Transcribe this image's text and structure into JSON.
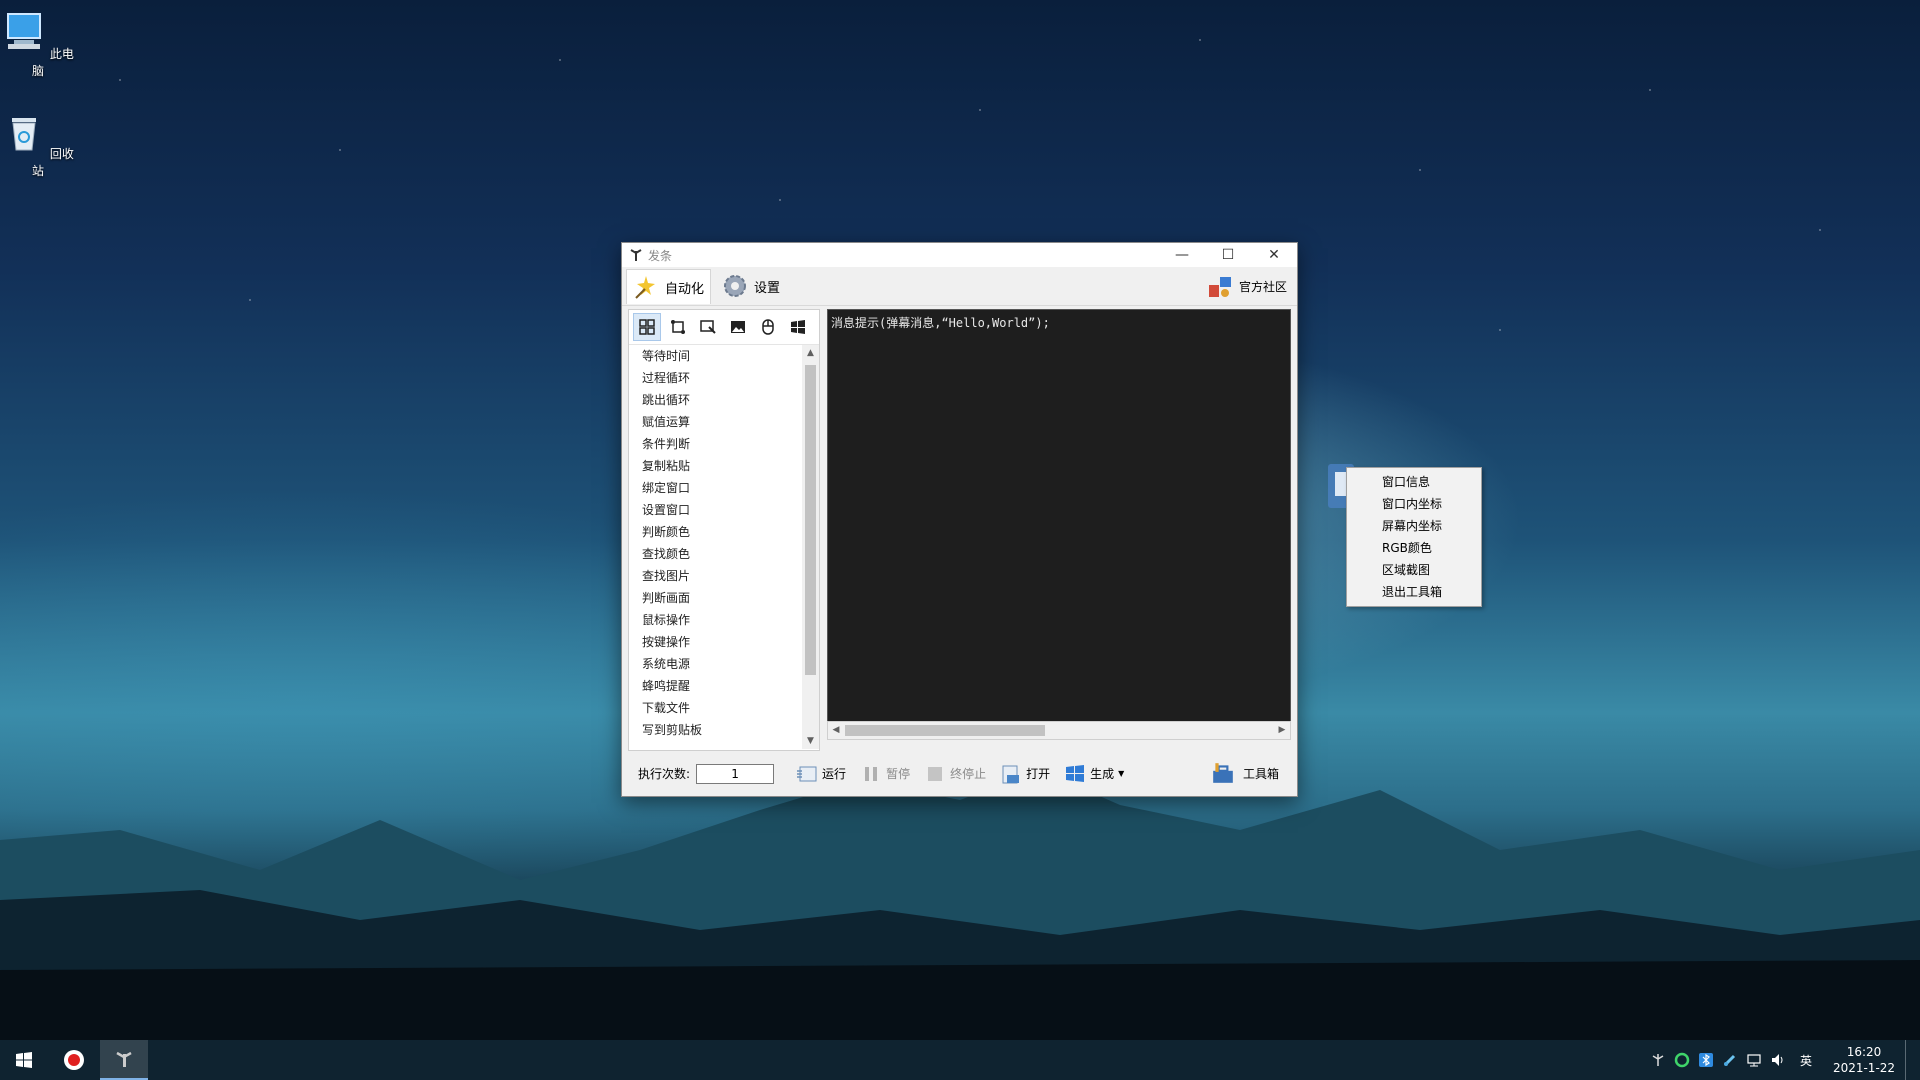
{
  "desktop": {
    "icons": [
      {
        "label": "此电脑",
        "icon": "computer-icon"
      },
      {
        "label": "回收站",
        "icon": "recycle-bin-icon"
      }
    ]
  },
  "window": {
    "title": "发条",
    "controls": {
      "minimize": "—",
      "maximize": "☐",
      "close": "✕"
    },
    "tabs": [
      {
        "label": "自动化",
        "icon": "magic-wand-icon",
        "active": true
      },
      {
        "label": "设置",
        "icon": "gear-icon",
        "active": false
      }
    ],
    "community_label": "官方社区",
    "category_icons": [
      "layout-grid-icon",
      "flow-icon",
      "window-select-icon",
      "image-icon",
      "mouse-icon",
      "windows-logo-icon"
    ],
    "commands": [
      "等待时间",
      "过程循环",
      "跳出循环",
      "赋值运算",
      "条件判断",
      "复制粘贴",
      "绑定窗口",
      "设置窗口",
      "判断颜色",
      "查找颜色",
      "查找图片",
      "判断画面",
      "鼠标操作",
      "按键操作",
      "系统电源",
      "蜂鸣提醒",
      "下载文件",
      "写到剪贴板"
    ],
    "editor_code": "消息提示(弹幕消息,“Hello,World”);",
    "bottom": {
      "exec_count_label": "执行次数:",
      "exec_count_value": "1",
      "run_label": "运行",
      "pause_label": "暂停",
      "stop_label": "终停止",
      "open_label": "打开",
      "generate_label": "生成",
      "toolbox_label": "工具箱"
    }
  },
  "context_menu": {
    "items": [
      "窗口信息",
      "窗口内坐标",
      "屏幕内坐标",
      "RGB颜色",
      "区域截图",
      "退出工具箱"
    ]
  },
  "taskbar": {
    "start_icon": "windows-start-icon",
    "apps": [
      {
        "name": "record-app-icon"
      },
      {
        "name": "fatiao-app-icon"
      }
    ],
    "tray_icons": [
      "tray-app-icon",
      "tray-green-circle-icon",
      "tray-bluetooth-icon",
      "tray-pen-icon",
      "network-icon",
      "volume-icon"
    ],
    "ime": "英",
    "time": "16:20",
    "date": "2021-1-22"
  },
  "colors": {
    "taskbar": "#0f2330",
    "editor_bg": "#1e1e1e",
    "window_bg": "#f0f0f0"
  }
}
